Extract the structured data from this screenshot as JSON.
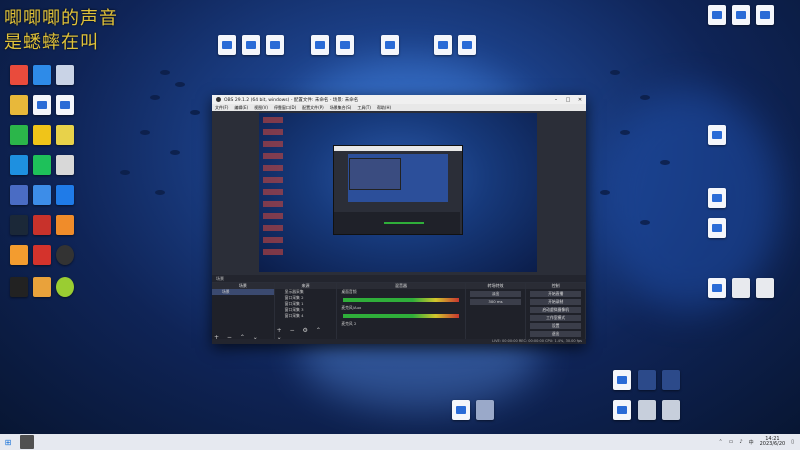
{
  "overlay": {
    "line1": "唧唧唧的声音",
    "line2": "是蟋蟀在叫"
  },
  "desktop_icons": [
    {
      "label": "",
      "kind": "app"
    },
    {
      "label": "",
      "kind": "app"
    }
  ],
  "obs": {
    "title": "OBS 29.1.2 (64 bit, windows) - 配置文件: 未命名 - 场景: 未命名",
    "menu": [
      "文件(F)",
      "编辑(E)",
      "视图(V)",
      "停靠窗口(D)",
      "配置文件(P)",
      "场景集合(S)",
      "工具(T)",
      "帮助(H)"
    ],
    "dock_headers": [
      "场景",
      "来源",
      "混音器",
      "转场特效",
      "控制"
    ],
    "scenes": [
      "场景"
    ],
    "sources": [
      "显示器采集",
      "窗口采集 2",
      "窗口采集 1",
      "窗口采集 3",
      "窗口采集 4"
    ],
    "mixer": [
      "桌面音频",
      "麦克风/Aux",
      "麦克风 2"
    ],
    "transition": {
      "name": "淡出",
      "duration": "300 ms"
    },
    "controls": [
      "开始直播",
      "开始录制",
      "启动虚拟摄像机",
      "工作室模式",
      "设置",
      "退出"
    ],
    "status": "LIVE: 00:00:00  REC: 00:00:00  CPU: 1.4%, 30.00 fps"
  },
  "taskbar": {
    "start_icon": "windows-icon",
    "time": "14:21",
    "date": "2023/6/20"
  },
  "colors": {
    "overlay_text": "#e0c23a",
    "wallpaper_main": "#1b3f86",
    "obs_bg": "#2b2e38"
  }
}
